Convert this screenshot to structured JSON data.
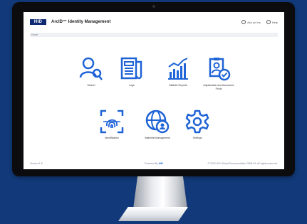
{
  "header": {
    "logo_text": "HID",
    "title": "ArcID™ Identity Management",
    "right_items": [
      "Ask an Ins",
      "Help"
    ]
  },
  "breadcrumb": "Home",
  "tiles": [
    {
      "label": "Search",
      "icon": "search-user-icon"
    },
    {
      "label": "Logs",
      "icon": "logs-document-icon"
    },
    {
      "label": "Statistic Reports",
      "icon": "statistics-chart-icon"
    },
    {
      "label": "Adjudication and Assurance Pools",
      "icon": "adjudication-check-icon"
    },
    {
      "label": "Identification",
      "icon": "fingerprint-scan-icon"
    },
    {
      "label": "Watchlist Management",
      "icon": "globe-user-icon"
    },
    {
      "label": "Settings",
      "icon": "gear-icon"
    }
  ],
  "footer": {
    "version": "Version 1.8",
    "powered_prefix": "Powered By",
    "powered_brand": "HID",
    "copyright": "© 2022 HID Global Documentation GB8L29. All rights reserved."
  },
  "colors": {
    "background": "#123a7a",
    "icon_blue": "#1f63d6",
    "logo_navy": "#0f2a72"
  }
}
